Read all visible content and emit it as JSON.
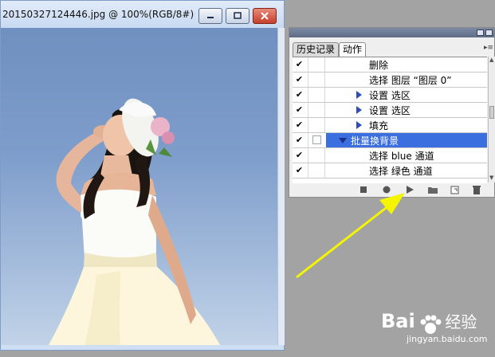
{
  "document_window": {
    "title": "20150327124446.jpg @ 100%(RGB/8#)",
    "buttons": [
      "minimize",
      "maximize",
      "close"
    ]
  },
  "actions_panel": {
    "tabs": [
      {
        "label": "历史记录",
        "active": false
      },
      {
        "label": "动作",
        "active": true
      }
    ],
    "rows": [
      {
        "checked": true,
        "label": "删除",
        "expander": "none",
        "selected": false
      },
      {
        "checked": true,
        "label": "选择 图层 “图层 0”",
        "expander": "none",
        "selected": false
      },
      {
        "checked": true,
        "label": "设置 选区",
        "expander": "collapsed",
        "selected": false
      },
      {
        "checked": true,
        "label": "设置 选区",
        "expander": "collapsed",
        "selected": false
      },
      {
        "checked": true,
        "label": "填充",
        "expander": "collapsed",
        "selected": false
      },
      {
        "checked": true,
        "label": "批量换背景",
        "expander": "expanded",
        "selected": true
      },
      {
        "checked": true,
        "label": "选择 blue 通道",
        "expander": "none",
        "selected": false
      },
      {
        "checked": true,
        "label": "选择 绿色 通道",
        "expander": "none",
        "selected": false
      }
    ],
    "toolbar_icons": [
      "stop-icon",
      "record-icon",
      "play-icon",
      "new-set-icon",
      "new-action-icon",
      "delete-icon"
    ]
  },
  "annotation": {
    "color": "#f5f500",
    "points_to": "play-icon"
  },
  "watermark": {
    "logo_text": "Bai",
    "logo_text_2": "经验",
    "url": "jingyan.baidu.com"
  }
}
